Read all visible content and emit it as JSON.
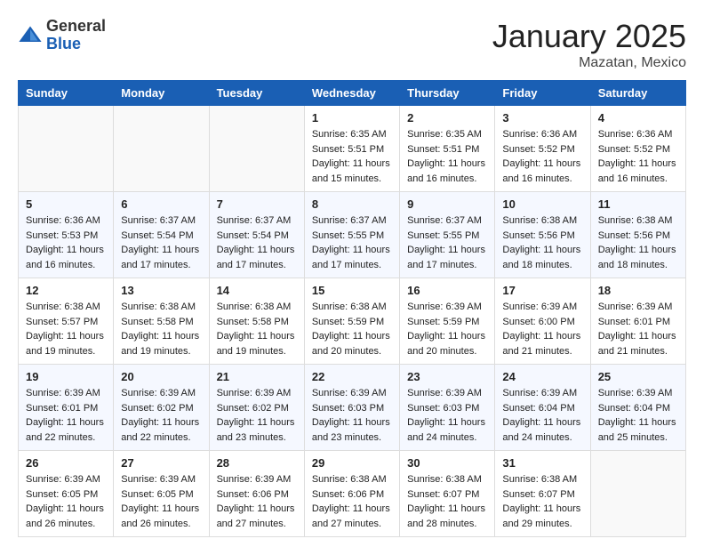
{
  "header": {
    "logo_general": "General",
    "logo_blue": "Blue",
    "month_title": "January 2025",
    "location": "Mazatan, Mexico"
  },
  "days_of_week": [
    "Sunday",
    "Monday",
    "Tuesday",
    "Wednesday",
    "Thursday",
    "Friday",
    "Saturday"
  ],
  "weeks": [
    [
      {
        "day": "",
        "info": ""
      },
      {
        "day": "",
        "info": ""
      },
      {
        "day": "",
        "info": ""
      },
      {
        "day": "1",
        "info": "Sunrise: 6:35 AM\nSunset: 5:51 PM\nDaylight: 11 hours\nand 15 minutes."
      },
      {
        "day": "2",
        "info": "Sunrise: 6:35 AM\nSunset: 5:51 PM\nDaylight: 11 hours\nand 16 minutes."
      },
      {
        "day": "3",
        "info": "Sunrise: 6:36 AM\nSunset: 5:52 PM\nDaylight: 11 hours\nand 16 minutes."
      },
      {
        "day": "4",
        "info": "Sunrise: 6:36 AM\nSunset: 5:52 PM\nDaylight: 11 hours\nand 16 minutes."
      }
    ],
    [
      {
        "day": "5",
        "info": "Sunrise: 6:36 AM\nSunset: 5:53 PM\nDaylight: 11 hours\nand 16 minutes."
      },
      {
        "day": "6",
        "info": "Sunrise: 6:37 AM\nSunset: 5:54 PM\nDaylight: 11 hours\nand 17 minutes."
      },
      {
        "day": "7",
        "info": "Sunrise: 6:37 AM\nSunset: 5:54 PM\nDaylight: 11 hours\nand 17 minutes."
      },
      {
        "day": "8",
        "info": "Sunrise: 6:37 AM\nSunset: 5:55 PM\nDaylight: 11 hours\nand 17 minutes."
      },
      {
        "day": "9",
        "info": "Sunrise: 6:37 AM\nSunset: 5:55 PM\nDaylight: 11 hours\nand 17 minutes."
      },
      {
        "day": "10",
        "info": "Sunrise: 6:38 AM\nSunset: 5:56 PM\nDaylight: 11 hours\nand 18 minutes."
      },
      {
        "day": "11",
        "info": "Sunrise: 6:38 AM\nSunset: 5:56 PM\nDaylight: 11 hours\nand 18 minutes."
      }
    ],
    [
      {
        "day": "12",
        "info": "Sunrise: 6:38 AM\nSunset: 5:57 PM\nDaylight: 11 hours\nand 19 minutes."
      },
      {
        "day": "13",
        "info": "Sunrise: 6:38 AM\nSunset: 5:58 PM\nDaylight: 11 hours\nand 19 minutes."
      },
      {
        "day": "14",
        "info": "Sunrise: 6:38 AM\nSunset: 5:58 PM\nDaylight: 11 hours\nand 19 minutes."
      },
      {
        "day": "15",
        "info": "Sunrise: 6:38 AM\nSunset: 5:59 PM\nDaylight: 11 hours\nand 20 minutes."
      },
      {
        "day": "16",
        "info": "Sunrise: 6:39 AM\nSunset: 5:59 PM\nDaylight: 11 hours\nand 20 minutes."
      },
      {
        "day": "17",
        "info": "Sunrise: 6:39 AM\nSunset: 6:00 PM\nDaylight: 11 hours\nand 21 minutes."
      },
      {
        "day": "18",
        "info": "Sunrise: 6:39 AM\nSunset: 6:01 PM\nDaylight: 11 hours\nand 21 minutes."
      }
    ],
    [
      {
        "day": "19",
        "info": "Sunrise: 6:39 AM\nSunset: 6:01 PM\nDaylight: 11 hours\nand 22 minutes."
      },
      {
        "day": "20",
        "info": "Sunrise: 6:39 AM\nSunset: 6:02 PM\nDaylight: 11 hours\nand 22 minutes."
      },
      {
        "day": "21",
        "info": "Sunrise: 6:39 AM\nSunset: 6:02 PM\nDaylight: 11 hours\nand 23 minutes."
      },
      {
        "day": "22",
        "info": "Sunrise: 6:39 AM\nSunset: 6:03 PM\nDaylight: 11 hours\nand 23 minutes."
      },
      {
        "day": "23",
        "info": "Sunrise: 6:39 AM\nSunset: 6:03 PM\nDaylight: 11 hours\nand 24 minutes."
      },
      {
        "day": "24",
        "info": "Sunrise: 6:39 AM\nSunset: 6:04 PM\nDaylight: 11 hours\nand 24 minutes."
      },
      {
        "day": "25",
        "info": "Sunrise: 6:39 AM\nSunset: 6:04 PM\nDaylight: 11 hours\nand 25 minutes."
      }
    ],
    [
      {
        "day": "26",
        "info": "Sunrise: 6:39 AM\nSunset: 6:05 PM\nDaylight: 11 hours\nand 26 minutes."
      },
      {
        "day": "27",
        "info": "Sunrise: 6:39 AM\nSunset: 6:05 PM\nDaylight: 11 hours\nand 26 minutes."
      },
      {
        "day": "28",
        "info": "Sunrise: 6:39 AM\nSunset: 6:06 PM\nDaylight: 11 hours\nand 27 minutes."
      },
      {
        "day": "29",
        "info": "Sunrise: 6:38 AM\nSunset: 6:06 PM\nDaylight: 11 hours\nand 27 minutes."
      },
      {
        "day": "30",
        "info": "Sunrise: 6:38 AM\nSunset: 6:07 PM\nDaylight: 11 hours\nand 28 minutes."
      },
      {
        "day": "31",
        "info": "Sunrise: 6:38 AM\nSunset: 6:07 PM\nDaylight: 11 hours\nand 29 minutes."
      },
      {
        "day": "",
        "info": ""
      }
    ]
  ]
}
